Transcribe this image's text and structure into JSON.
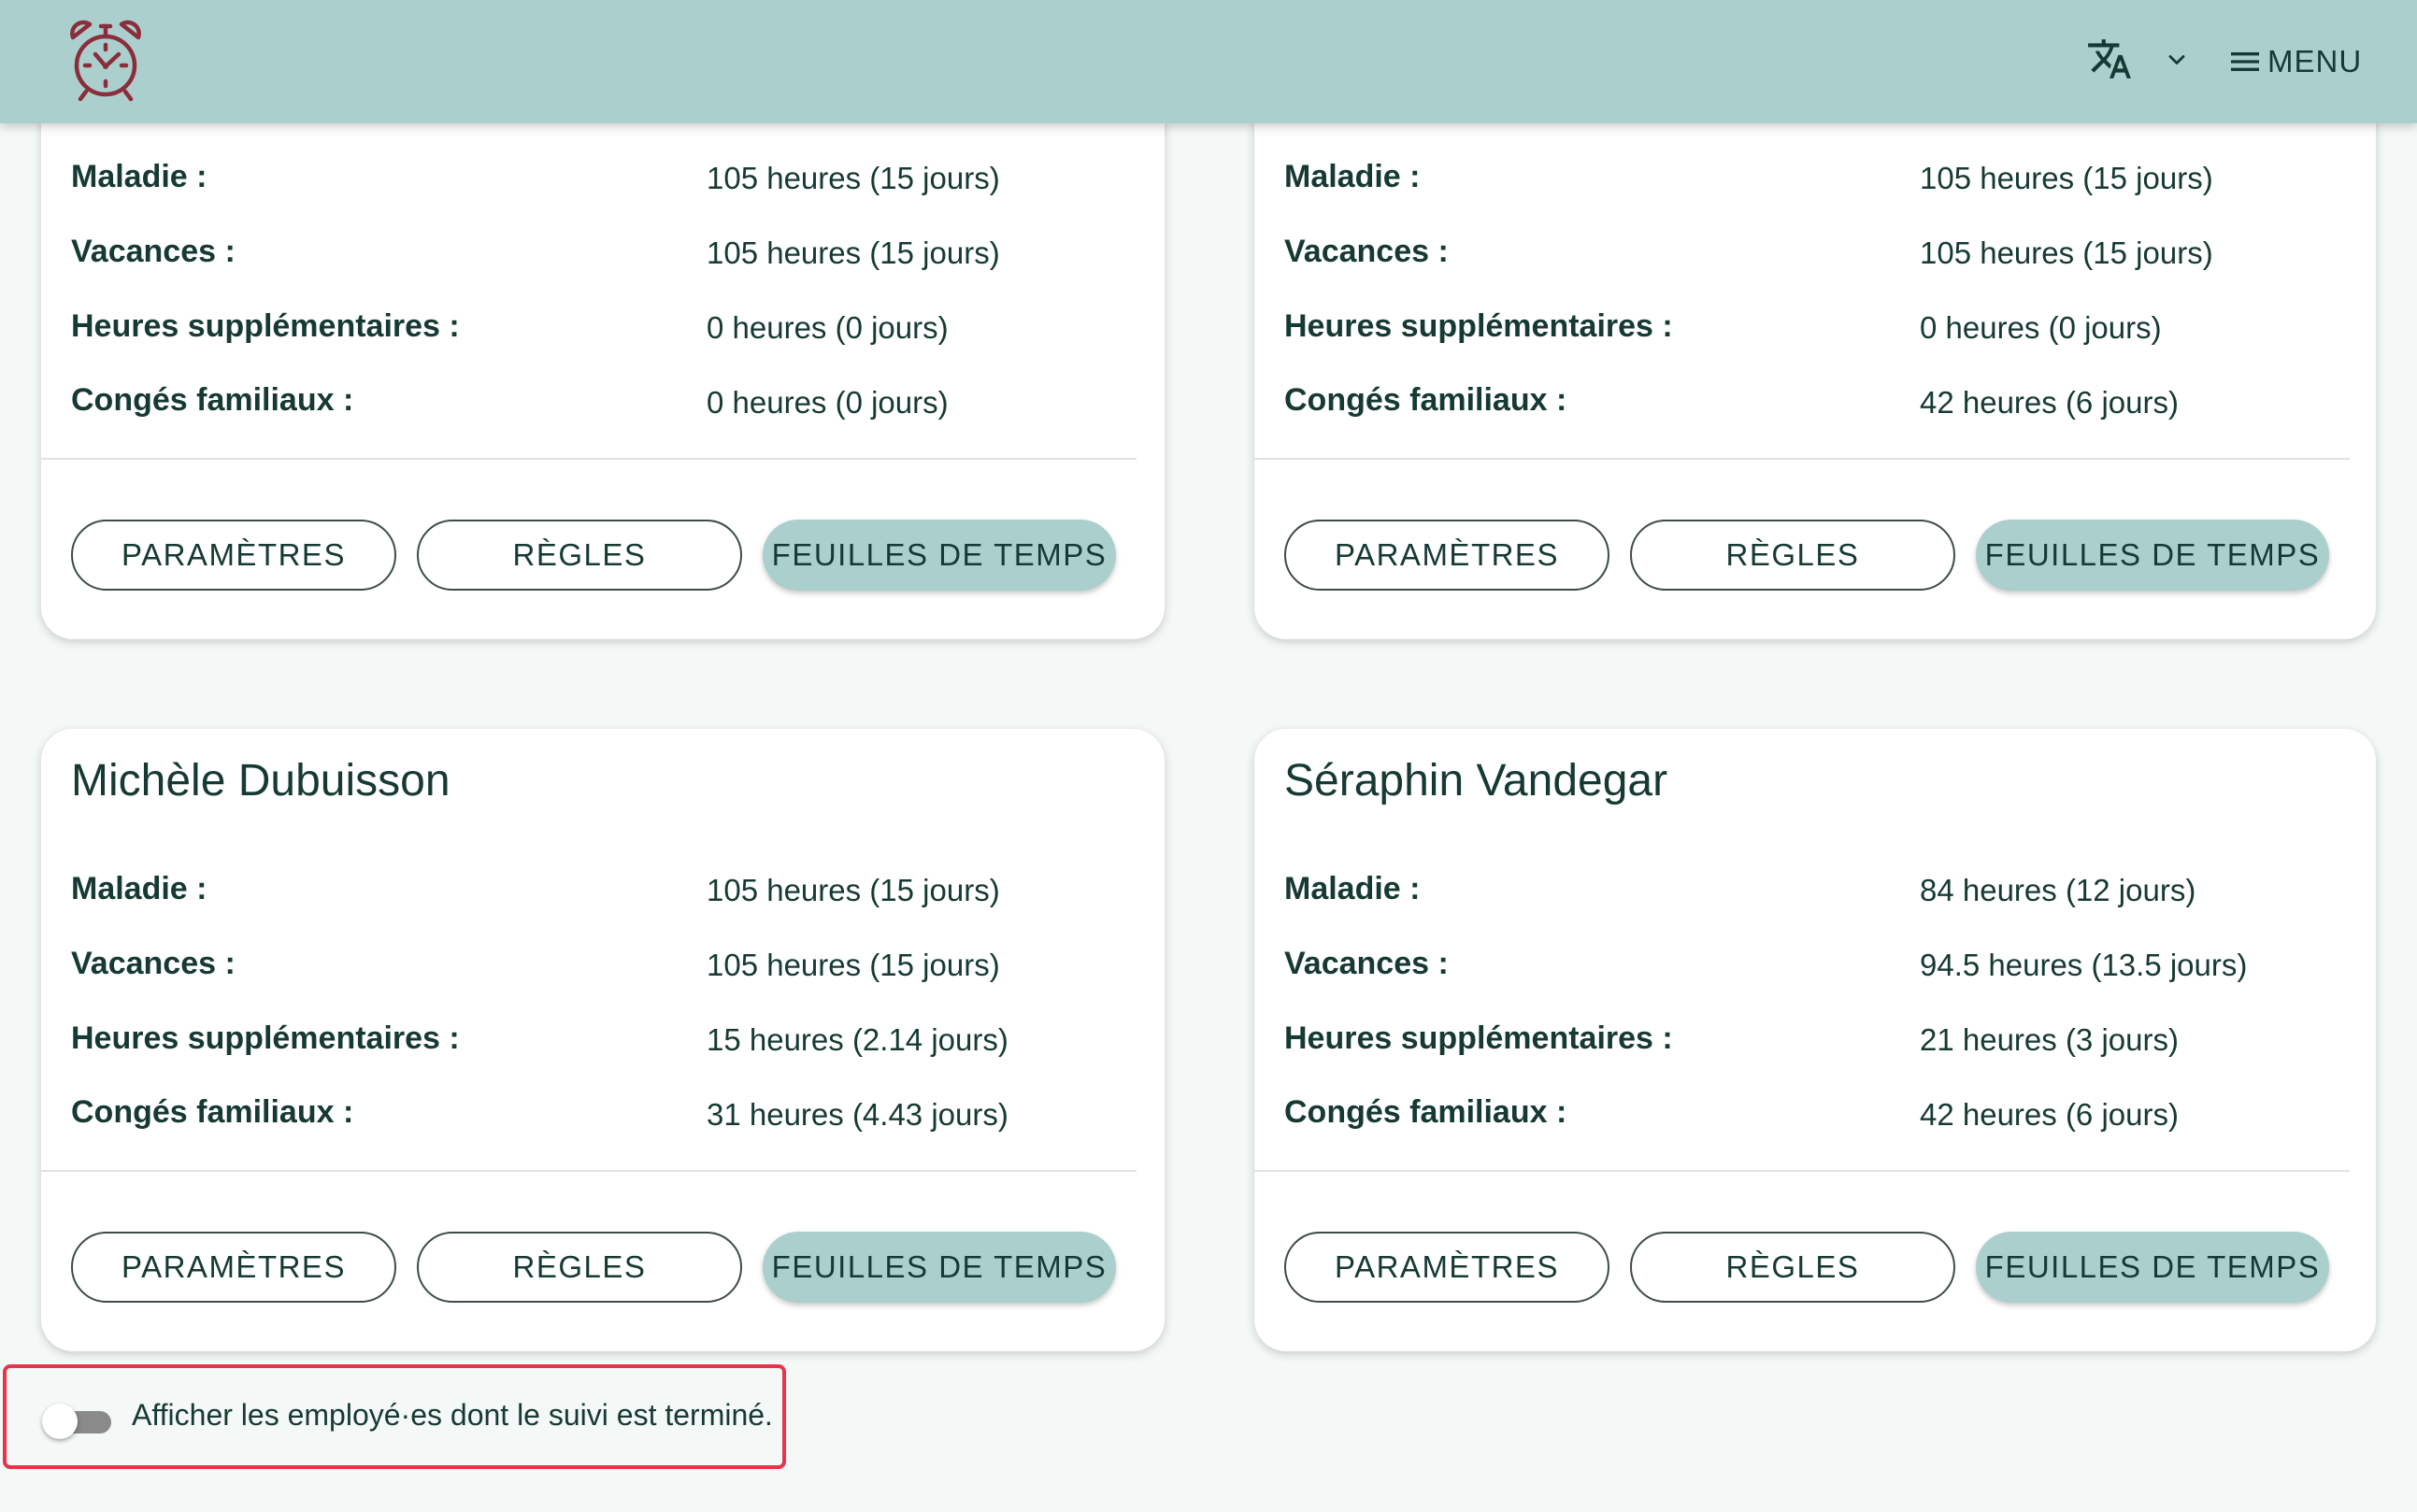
{
  "header": {
    "logo": "alarm-clock-logo",
    "language_icon": "translate-icon",
    "language_caret_icon": "chevron-down-icon",
    "menu_label": "MENU",
    "menu_icon": "hamburger-icon"
  },
  "colors": {
    "header_bg": "#abcfcc",
    "accent_button": "#abcfcc",
    "logo": "#8b2e3c",
    "highlight_border": "#e8334a",
    "text": "#163a33",
    "background": "#f4f8f7"
  },
  "cards": [
    {
      "name": "",
      "rows": [
        {
          "label": "Maladie :",
          "value": "105 heures (15 jours)"
        },
        {
          "label": "Vacances :",
          "value": "105 heures (15 jours)"
        },
        {
          "label": "Heures supplémentaires :",
          "value": "0 heures (0 jours)"
        },
        {
          "label": "Congés familiaux :",
          "value": "0 heures (0 jours)"
        }
      ],
      "buttons": {
        "settings": "PARAMÈTRES",
        "rules": "RÈGLES",
        "timesheets": "FEUILLES DE TEMPS"
      }
    },
    {
      "name": "",
      "rows": [
        {
          "label": "Maladie :",
          "value": "105 heures (15 jours)"
        },
        {
          "label": "Vacances :",
          "value": "105 heures (15 jours)"
        },
        {
          "label": "Heures supplémentaires :",
          "value": "0 heures (0 jours)"
        },
        {
          "label": "Congés familiaux :",
          "value": "42 heures (6 jours)"
        }
      ],
      "buttons": {
        "settings": "PARAMÈTRES",
        "rules": "RÈGLES",
        "timesheets": "FEUILLES DE TEMPS"
      }
    },
    {
      "name": "Michèle Dubuisson",
      "rows": [
        {
          "label": "Maladie :",
          "value": "105 heures (15 jours)"
        },
        {
          "label": "Vacances :",
          "value": "105 heures (15 jours)"
        },
        {
          "label": "Heures supplémentaires :",
          "value": "15 heures (2.14 jours)"
        },
        {
          "label": "Congés familiaux :",
          "value": "31 heures (4.43 jours)"
        }
      ],
      "buttons": {
        "settings": "PARAMÈTRES",
        "rules": "RÈGLES",
        "timesheets": "FEUILLES DE TEMPS"
      }
    },
    {
      "name": "Séraphin Vandegar",
      "rows": [
        {
          "label": "Maladie :",
          "value": "84 heures (12 jours)"
        },
        {
          "label": "Vacances :",
          "value": "94.5 heures (13.5 jours)"
        },
        {
          "label": "Heures supplémentaires :",
          "value": "21 heures (3 jours)"
        },
        {
          "label": "Congés familiaux :",
          "value": "42 heures (6 jours)"
        }
      ],
      "buttons": {
        "settings": "PARAMÈTRES",
        "rules": "RÈGLES",
        "timesheets": "FEUILLES DE TEMPS"
      }
    }
  ],
  "footer_toggle": {
    "label": "Afficher les employé·es dont le suivi est terminé.",
    "checked": false
  }
}
